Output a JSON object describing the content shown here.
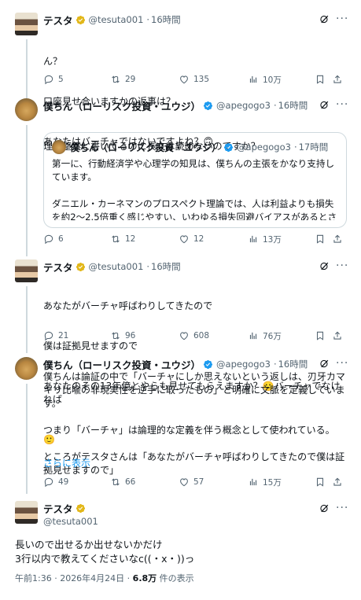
{
  "tweets": [
    {
      "name": "テスタ",
      "handle": "@tesuta001",
      "time": "16時間",
      "lines": [
        "ん？",
        "口座見せ合いますかの返事は？",
        "あなたはバーチャではないですよね？🙃"
      ],
      "replies": "5",
      "retweets": "29",
      "likes": "135",
      "views": "10万"
    },
    {
      "name": "僕ちん（ローリスク投資・ユウジ）",
      "handle": "@apegogo3",
      "time": "16時間",
      "lines": [
        "理論整然と書いてるのに長文は読めないのですか？"
      ],
      "quote": {
        "name": "僕ちん（ローリスク投資・ユウジ）",
        "handle": "@apegogo3",
        "time": "17時間",
        "text": "第一に、行動経済学や心理学の知見は、僕ちんの主張をかなり支持しています。\n\nダニエル・カーネマンのプロスペクト理論では、人は利益よりも損失を約2〜2.5倍重く感じやすい、いわゆる損失回避バイアスがあるとされて…"
      },
      "replies": "6",
      "retweets": "12",
      "likes": "12",
      "views": "13万"
    },
    {
      "name": "テスタ",
      "handle": "@tesuta001",
      "time": "16時間",
      "lines": [
        "あなたがバーチャ呼ばわりしてきたので",
        "僕は証拠見せますので",
        "あなたのその13年億とやらも見せてもらえますか？🙂バーチャでなければ",
        "🙂"
      ],
      "replies": "21",
      "retweets": "96",
      "likes": "608",
      "views": "76万"
    },
    {
      "name": "僕ちん（ローリスク投資・ユウジ）",
      "handle": "@apegogo3",
      "time": "16時間",
      "text": "僕ちんは論証の中で「バーチャにしか思えないという返しは、刃牙カマキリ比喩の非現実性を逆手に取ったもの」と明確に文脈を定義しています。\n\nつまり「バーチャ」は論理的な定義を伴う概念として使われている。\n\nところがテスタさんは「あなたがバーチャ呼ばわりしてきたので僕は証拠見せますので」",
      "show_more": "さらに表示",
      "replies": "49",
      "retweets": "66",
      "likes": "57",
      "views": "15万"
    }
  ],
  "main": {
    "name": "テスタ",
    "handle": "@tesuta001",
    "lines": [
      "長いので出せるか出せないかだけ",
      "3行以内で教えてくださいなc((・x・))っ"
    ],
    "timestamp": "午前1:36 · 2026年4月24日 · ",
    "views_count": "6.8万",
    "views_label": " 件の表示"
  },
  "colors": {
    "gold_badge": "#e2b719",
    "blue_badge": "#1d9bf0",
    "gray": "#536471",
    "link": "#1d9bf0"
  }
}
